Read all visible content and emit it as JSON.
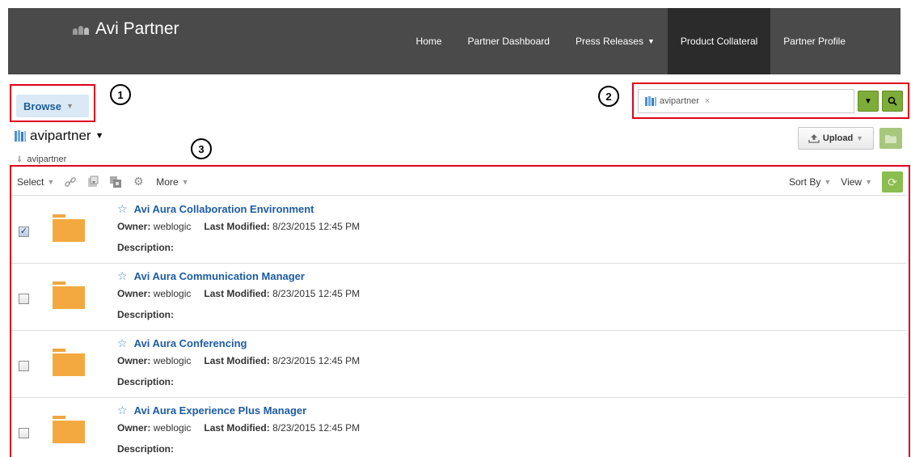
{
  "header": {
    "brand": "Avi Partner",
    "nav": [
      {
        "label": "Home",
        "active": false,
        "dropdown": false
      },
      {
        "label": "Partner Dashboard",
        "active": false,
        "dropdown": false
      },
      {
        "label": "Press Releases",
        "active": false,
        "dropdown": true
      },
      {
        "label": "Product Collateral",
        "active": true,
        "dropdown": false
      },
      {
        "label": "Partner Profile",
        "active": false,
        "dropdown": false
      }
    ]
  },
  "callouts": [
    "1",
    "2",
    "3"
  ],
  "browse": {
    "label": "Browse"
  },
  "search": {
    "chip_label": "avipartner",
    "chip_remove": "×"
  },
  "library": {
    "title": "avipartner",
    "breadcrumb": "avipartner"
  },
  "actions": {
    "upload_label": "Upload"
  },
  "toolbar": {
    "select_label": "Select",
    "more_label": "More",
    "sort_label": "Sort By",
    "view_label": "View"
  },
  "items": [
    {
      "title": "Avi Aura Collaboration Environment",
      "owner_label": "Owner:",
      "owner": "weblogic",
      "modified_label": "Last Modified:",
      "modified": "8/23/2015 12:45 PM",
      "description_label": "Description:",
      "checked": true
    },
    {
      "title": "Avi Aura Communication Manager",
      "owner_label": "Owner:",
      "owner": "weblogic",
      "modified_label": "Last Modified:",
      "modified": "8/23/2015 12:45 PM",
      "description_label": "Description:",
      "checked": false
    },
    {
      "title": "Avi Aura Conferencing",
      "owner_label": "Owner:",
      "owner": "weblogic",
      "modified_label": "Last Modified:",
      "modified": "8/23/2015 12:45 PM",
      "description_label": "Description:",
      "checked": false
    },
    {
      "title": "Avi Aura Experience Plus Manager",
      "owner_label": "Owner:",
      "owner": "weblogic",
      "modified_label": "Last Modified:",
      "modified": "8/23/2015 12:45 PM",
      "description_label": "Description:",
      "checked": false
    }
  ],
  "colors": {
    "accent_green": "#7dad38",
    "link_blue": "#1c5ca3",
    "folder_orange": "#f3a93f",
    "annotation_red": "#e0001b"
  }
}
